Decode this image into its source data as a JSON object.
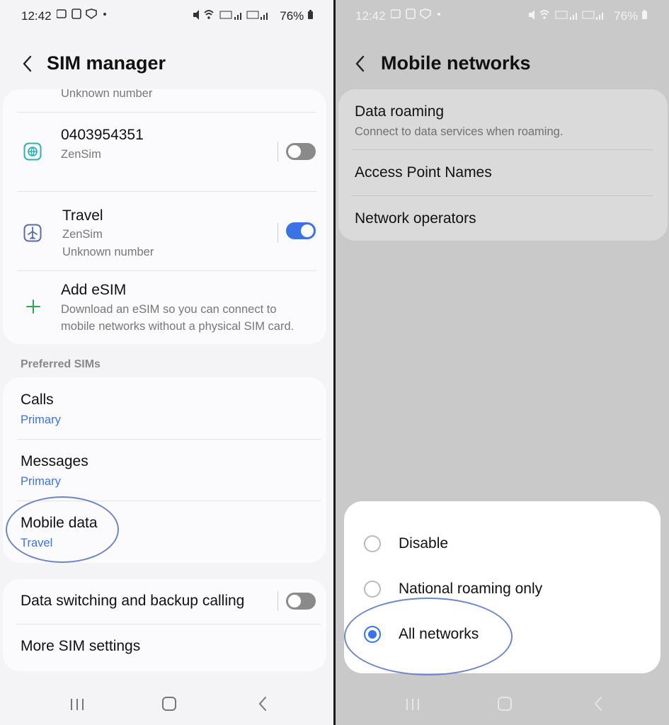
{
  "left": {
    "status": {
      "time": "12:42",
      "battery": "76%"
    },
    "title": "SIM manager",
    "sims": [
      {
        "partial_secondary": "Unknown number"
      },
      {
        "name": "0403954351",
        "carrier": "ZenSim",
        "enabled": false,
        "icon": "globe-sim-icon"
      },
      {
        "name": "Travel",
        "carrier": "ZenSim",
        "number": "Unknown number",
        "enabled": true,
        "icon": "airplane-sim-icon"
      }
    ],
    "add_esim": {
      "label": "Add eSIM",
      "desc_line1": "Download an eSIM so you can connect to",
      "desc_line2": "mobile networks without a physical SIM card."
    },
    "preferred_label": "Preferred SIMs",
    "preferred": [
      {
        "label": "Calls",
        "value": "Primary"
      },
      {
        "label": "Messages",
        "value": "Primary"
      },
      {
        "label": "Mobile data",
        "value": "Travel"
      }
    ],
    "data_switching": {
      "label": "Data switching and backup calling",
      "enabled": false
    },
    "more_settings": "More SIM settings"
  },
  "right": {
    "status": {
      "time": "12:42",
      "battery": "76%"
    },
    "title": "Mobile networks",
    "items": [
      {
        "label": "Data roaming",
        "desc": "Connect to data services when roaming."
      },
      {
        "label": "Access Point Names"
      },
      {
        "label": "Network operators"
      }
    ],
    "roaming_options": [
      {
        "label": "Disable",
        "selected": false
      },
      {
        "label": "National roaming only",
        "selected": false
      },
      {
        "label": "All networks",
        "selected": true
      }
    ]
  },
  "colors": {
    "accent": "#3a73e5",
    "accent_text": "#3e72e0",
    "annotation": "#6d86c6",
    "add_icon": "#2fa84f"
  }
}
